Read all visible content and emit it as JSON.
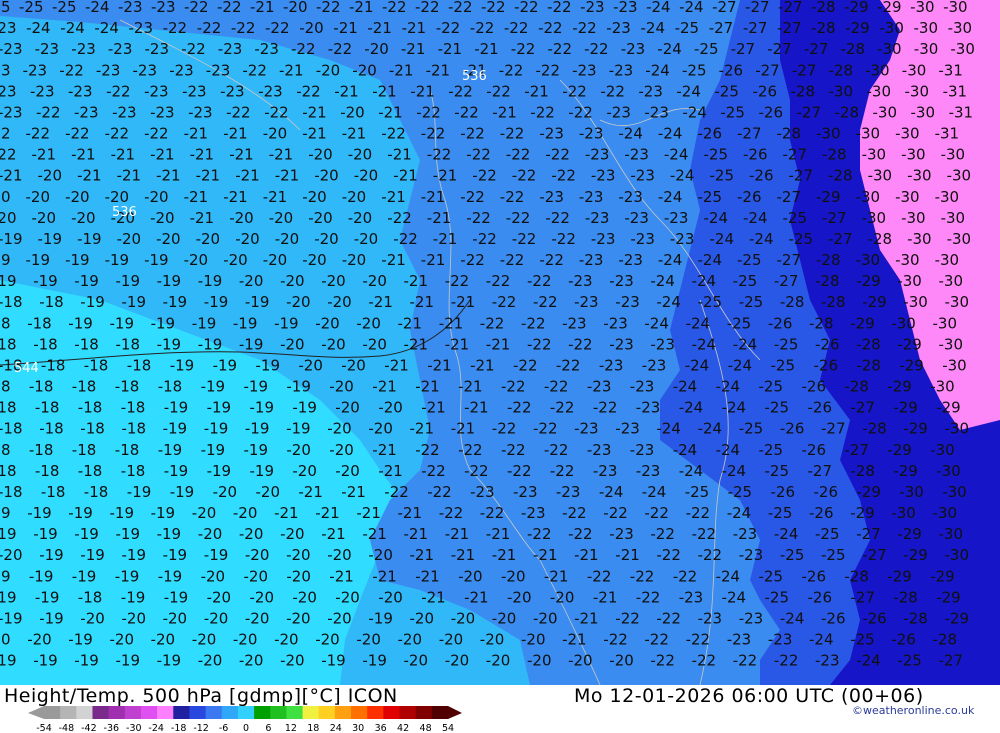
{
  "title": "Height/Temp. 500 hPa [gdmp][°C] ICON",
  "datetime": "Mo 12-01-2026 06:00 UTC (00+06)",
  "credit": "©weatheronline.co.uk",
  "legend": {
    "ticks": [
      "-54",
      "-48",
      "-42",
      "-36",
      "-30",
      "-24",
      "-18",
      "-12",
      "-6",
      "0",
      "6",
      "12",
      "18",
      "24",
      "30",
      "36",
      "42",
      "48",
      "54"
    ],
    "colors": [
      "#9a9a9a",
      "#b5b5b5",
      "#d2d2d2",
      "#7a2a8a",
      "#a030b0",
      "#c040d0",
      "#e050f0",
      "#ff80ff",
      "#2020a0",
      "#2848e0",
      "#3c78f0",
      "#30a8f8",
      "#30d0ff",
      "#00a000",
      "#20c020",
      "#40e040",
      "#f0f040",
      "#ffd020",
      "#ffa010",
      "#ff7000",
      "#ff3000",
      "#e00000",
      "#b00000",
      "#800000",
      "#500000"
    ]
  },
  "map": {
    "zone_colors": {
      "cyan": "#30dcff",
      "lightblue": "#30b8f8",
      "midblue": "#3a8cf0",
      "blue": "#2a58e6",
      "darkblue": "#1616c8",
      "pink": "#ff88f8"
    },
    "geopotential_labels": [
      "536",
      "536",
      "544"
    ],
    "rows": [
      "25 25 25 24 23 23 22 22 21 20 22 21 22 22 22 22 22 22 23 23 24 24 27 27 27 28 29 29 30 30",
      "23 24 24 24 23 22 22 22 22 20 21 21 21 22 22 22 22 22 23 24 25 27 27 27 28 29 30 30 30",
      "23 23 23 23 23 22 23 23 22 22 20 21 21 21 22 22 22 23 24 25 27 27 27 28 30 30 30",
      "23 23 22 23 23 23 23 22 21 20 20 21 21 21 22 22 23 23 24 25 26 27 27 28 30 30 31",
      "23 23 23 22 23 23 23 23 22 21 21 21 22 22 21 22 22 23 24 25 26 28 30 30 30 31",
      "23 22 23 23 23 23 22 22 21 20 21 22 22 21 22 22 23 23 24 25 26 27 28 30 30 31",
      "22 22 22 22 22 21 21 20 21 21 22 22 22 22 23 23 24 24 26 27 28 30 30 30 31",
      "22 21 21 21 21 21 21 21 20 20 21 22 22 22 22 23 23 24 25 26 27 28 30 30 30",
      "21 20 21 21 21 21 21 21 20 20 21 21 22 22 22 23 23 24 25 26 27 28 30 30 30",
      "20 20 20 20 20 21 21 21 20 20 21 21 22 22 23 23 23 24 25 26 27 29 30 30 30",
      "20 20 20 20 20 21 20 20 20 20 22 21 22 22 22 23 23 23 24 24 25 27 30 30 30",
      "19 19 19 20 20 20 20 20 20 20 22 21 22 22 22 23 23 23 24 24 25 27 28 30 30",
      "19 19 19 19 19 20 20 20 20 20 21 21 22 22 22 23 23 24 24 25 27 28 30 30 30",
      "19 19 19 19 19 19 20 20 20 20 21 22 22 22 23 23 24 24 25 27 28 29 30 30",
      "18 18 19 19 19 19 19 20 20 21 21 21 22 22 23 23 24 25 25 28 28 29 30 30",
      "18 18 19 19 19 19 19 19 20 20 21 21 22 22 23 23 24 24 25 26 28 29 30 30",
      "18 18 18 18 19 19 19 20 20 20 21 21 21 22 22 23 23 24 24 25 26 28 29 30",
      "18 18 18 18 19 19 19 20 20 21 21 21 22 22 23 23 24 24 25 26 28 29 30",
      "18 18 18 18 18 19 19 19 20 21 21 21 22 22 23 23 24 24 25 26 28 29 30",
      "18 18 18 18 19 19 19 19 20 20 21 21 22 22 22 23 24 24 25 26 27 29 29",
      "18 18 18 18 19 19 19 19 20 20 21 21 22 22 23 23 24 24 25 26 27 28 29 30",
      "18 18 18 18 19 19 19 20 20 21 22 22 22 22 23 23 24 24 25 26 27 29 30",
      "18 18 18 18 19 19 19 20 20 21 22 22 22 22 23 23 24 24 25 27 28 29 30",
      "18 18 18 19 19 20 20 21 21 22 22 23 23 23 24 24 25 25 26 26 29 30 30",
      "19 19 19 19 19 20 20 21 21 21 21 22 22 23 22 22 22 22 24 25 26 29 30 30",
      "19 19 19 19 19 20 20 20 21 21 21 21 21 22 22 23 22 22 23 24 25 27 29 30",
      "20 19 19 19 19 19 20 20 20 20 21 21 21 21 21 21 22 22 23 25 25 27 29 30",
      "19 19 19 19 19 20 20 20 21 21 21 20 20 21 22 22 22 24 25 26 28 29 29",
      "19 19 18 19 19 20 20 20 20 20 21 21 20 20 21 22 23 24 25 26 27 28 29",
      "19 19 20 20 20 20 20 20 20 19 20 20 20 20 21 22 22 23 23 24 26 26 28 29",
      "20 20 19 20 20 20 20 20 20 20 20 20 20 20 21 22 22 22 23 23 24 25 26 28",
      "19 19 19 19 19 20 20 20 19 19 20 20 20 20 20 20 22 22 22 22 23 24 25 27"
    ]
  }
}
